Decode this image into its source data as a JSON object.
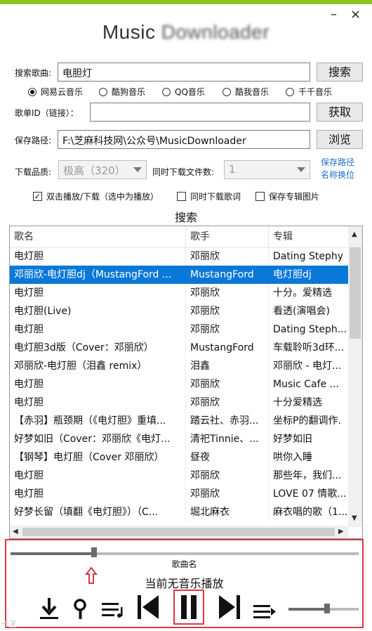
{
  "window": {
    "title_visible": "Music ",
    "title_obscured": "Downloader",
    "minimize": "–",
    "close": "×"
  },
  "search": {
    "label": "搜索歌曲:",
    "value": "电胆灯",
    "button": "搜索"
  },
  "sources": {
    "selected": 0,
    "options": [
      "网易云音乐",
      "酷狗音乐",
      "QQ音乐",
      "酷我音乐",
      "千千音乐"
    ]
  },
  "playlist": {
    "label": "歌单ID（链接）：",
    "value": "",
    "button": "获取"
  },
  "save": {
    "label": "保存路径:",
    "value": "F:\\芝麻科技网\\公众号\\MusicDownloader",
    "button": "浏览"
  },
  "quality": {
    "label": "下载品质:",
    "value": "极高（320）"
  },
  "concurrent": {
    "label": "同时下载文件数:",
    "value": "1"
  },
  "links": {
    "line1": "保存路径",
    "line2": "名称换位"
  },
  "options": [
    {
      "label": "双击播放/下载（选中为播放）",
      "checked": true
    },
    {
      "label": "同时下载歌词",
      "checked": false
    },
    {
      "label": "保存专辑图片",
      "checked": false
    }
  ],
  "section_title": "搜索",
  "table": {
    "headers": [
      "歌名",
      "歌手",
      "专辑"
    ],
    "selected_row": 1,
    "rows": [
      [
        "电灯胆",
        "邓丽欣",
        "Dating Stephy"
      ],
      [
        "邓丽欣-电灯胆dj（MustangFord ...",
        "MustangFord",
        "电灯胆dj"
      ],
      [
        "电灯胆",
        "邓丽欣",
        "十分。爱精选"
      ],
      [
        "电灯胆(Live)",
        "邓丽欣",
        "看透(演唱会)"
      ],
      [
        "电灯胆",
        "邓丽欣",
        "Dating Steph..."
      ],
      [
        "电灯胆3d版（Cover：邓丽欣）",
        "MustangFord",
        "车载聆听3d环..."
      ],
      [
        "邓丽欣-电灯胆（泪鑫 remix）",
        "泪鑫",
        "邓丽欣 - 电灯..."
      ],
      [
        "电灯胆",
        "邓丽欣",
        "Music Cafe ..."
      ],
      [
        "电灯胆",
        "邓丽欣",
        "十分爱精选"
      ],
      [
        "【赤羽】瓶颈期（《电灯胆》重填...",
        "踏云社、赤羽...",
        "坐标P的翻调作."
      ],
      [
        "好梦如旧（Cover：邓丽欣《电灯...",
        "清祀Tinnie、...",
        "好梦如旧"
      ],
      [
        "【钢琴】电灯胆（Cover 邓丽欣）",
        "昼夜",
        "哄你入睡"
      ],
      [
        "电灯胆",
        "邓丽欣",
        "那些年，我们..."
      ],
      [
        "电灯胆",
        "邓丽欣",
        "LOVE 07 情歌..."
      ],
      [
        "好梦长留（填翻《电灯胆》）（C...",
        "堀北麻衣",
        "麻衣唱的歌（1..."
      ]
    ]
  },
  "player": {
    "song_label": "歌曲名",
    "status": "当前无音乐播放",
    "progress": 0.24,
    "volume": 0.55
  },
  "watermark": "卡王",
  "colors": {
    "accent_green": "#8fc31f",
    "selection_blue": "#0a78d7",
    "highlight_red": "#d43a46"
  }
}
